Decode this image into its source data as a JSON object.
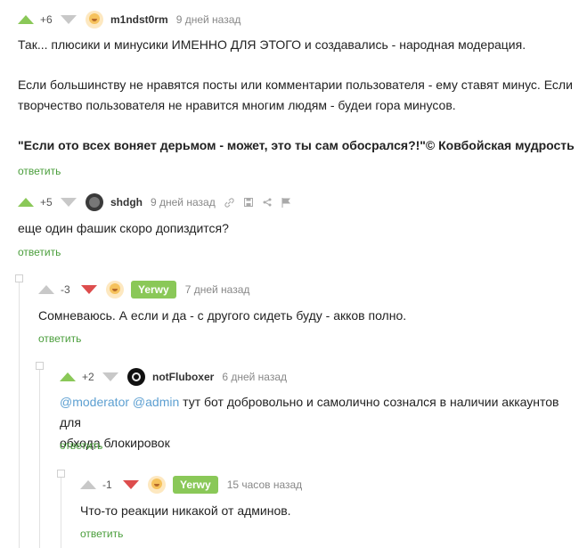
{
  "comments": [
    {
      "score": "+6",
      "nick": "m1ndst0rm",
      "time": "9 дней назад",
      "lines": [
        "Так... плюсики и минусики ИМЕННО ДЛЯ ЭТОГО и создавались - народная модерация.",
        "Если большинству не нравятся посты или комментарии пользователя - ему ставят минус. Если",
        "творчество пользователя не нравится многим людям - будеи гора минусов.",
        "\"Если ото всех воняет дерьмом - может, это ты сам обосрался?!\"© Ковбойская мудрость"
      ],
      "reply": "ответить"
    },
    {
      "score": "+5",
      "nick": "shdgh",
      "time": "9 дней назад",
      "lines": [
        "еще один фашик скоро допиздится?"
      ],
      "reply": "ответить"
    },
    {
      "score": "-3",
      "nick": "Yerwy",
      "time": "7 дней назад",
      "lines": [
        "Сомневаюсь. А если и да - с другого сидеть буду - акков полно."
      ],
      "reply": "ответить"
    },
    {
      "score": "+2",
      "nick": "notFluboxer",
      "time": "6 дней назад",
      "mention1": "@moderator",
      "mention2": "@admin",
      "line1_rest": " тут бот добровольно и самолично сознался в наличии аккаунтов для",
      "line2": "обхода блокировок",
      "reply": "ответить"
    },
    {
      "score": "-1",
      "nick": "Yerwy",
      "time": "15 часов назад",
      "lines": [
        "Что-то реакции никакой от админов."
      ],
      "reply": "ответить"
    }
  ],
  "icons": [
    "link-icon",
    "save-icon",
    "share-icon",
    "flag-icon"
  ],
  "colors": {
    "accent": "#8ac858",
    "minus": "#dd4d4d",
    "reply": "#4a9e3b",
    "mention": "#5c9fd1"
  }
}
